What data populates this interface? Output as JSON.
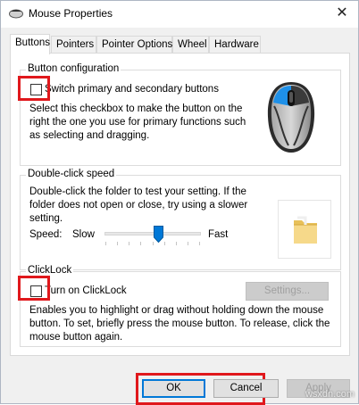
{
  "window": {
    "title": "Mouse Properties",
    "close_glyph": "✕"
  },
  "tabs": [
    {
      "label": "Buttons",
      "active": true
    },
    {
      "label": "Pointers",
      "active": false
    },
    {
      "label": "Pointer Options",
      "active": false
    },
    {
      "label": "Wheel",
      "active": false
    },
    {
      "label": "Hardware",
      "active": false
    }
  ],
  "button_config": {
    "title": "Button configuration",
    "checkbox_label": "Switch primary and secondary buttons",
    "checked": false,
    "description": [
      "Select this checkbox to make the button on the",
      "right the one you use for primary functions such",
      "as selecting and dragging."
    ]
  },
  "double_click": {
    "title": "Double-click speed",
    "description": [
      "Double-click the folder to test your setting. If the",
      "folder does not open or close, try using a slower",
      "setting."
    ],
    "speed_label": "Speed:",
    "slow_label": "Slow",
    "fast_label": "Fast",
    "speed_value_fraction": 0.5
  },
  "clicklock": {
    "title": "ClickLock",
    "checkbox_label": "Turn on ClickLock",
    "checked": false,
    "settings_button": "Settings...",
    "description": [
      "Enables you to highlight or drag without holding down the mouse",
      "button. To set, briefly press the mouse button. To release, click the",
      "mouse button again."
    ]
  },
  "footer": {
    "ok": "OK",
    "cancel": "Cancel",
    "apply": "Apply"
  },
  "watermark": "wsxdn.com",
  "colors": {
    "highlight_red": "#e0181c",
    "mouse_blue": "#1e90e8",
    "mouse_gray": "#8a8a8a"
  },
  "icons": {
    "title": "mouse-icon",
    "folder": "folder-icon",
    "mouse_illustration": "mouse-illustration"
  }
}
